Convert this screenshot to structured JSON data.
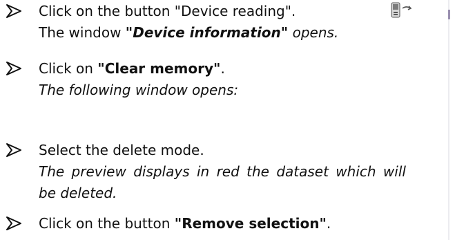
{
  "steps": [
    {
      "bullet_icon": "arrowhead-bullet",
      "line1_text": "Click on the button \"Device reading\".",
      "line2_prefix": "The window ",
      "line2_bold": "\"Device information\"",
      "line2_suffix": " opens.",
      "icon": "device-reading-icon"
    },
    {
      "bullet_icon": "arrowhead-bullet",
      "line1_prefix": "Click on ",
      "line1_bold": "\"Clear memory\"",
      "line1_suffix": ".",
      "line2_text": "The following window opens:"
    },
    {
      "bullet_icon": "arrowhead-bullet",
      "line1_text": "Select the delete mode.",
      "line2_text": "The preview displays in red the dataset which will",
      "line3_text": "be deleted."
    },
    {
      "bullet_icon": "arrowhead-bullet",
      "line1_prefix": "Click on the button ",
      "line1_bold": "\"Remove selection\"",
      "line1_suffix": "."
    }
  ]
}
